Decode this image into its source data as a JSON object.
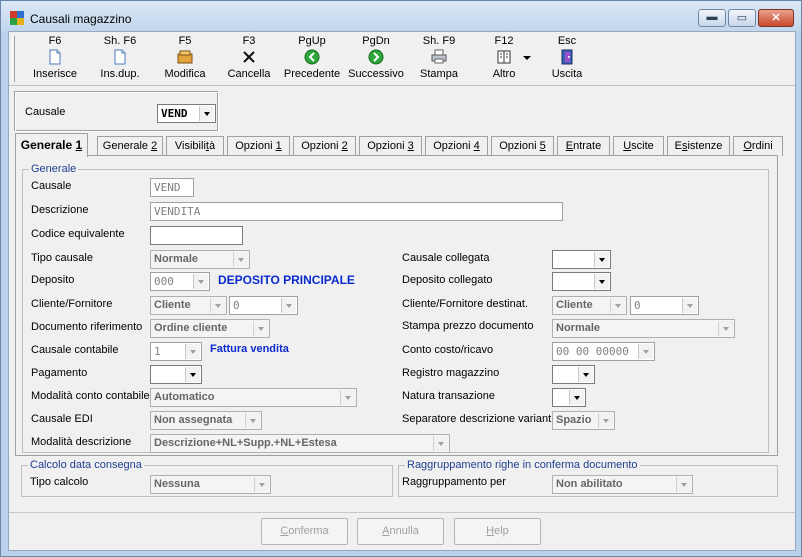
{
  "window": {
    "title": "Causali magazzino",
    "min": "▬",
    "max": "▭",
    "close": "✕"
  },
  "toolbar": [
    {
      "key": "F6",
      "label": "Inserisce",
      "icon": "new-document-icon"
    },
    {
      "key": "Sh. F6",
      "label": "Ins.dup.",
      "icon": "duplicate-document-icon"
    },
    {
      "key": "F5",
      "label": "Modifica",
      "icon": "edit-icon"
    },
    {
      "key": "F3",
      "label": "Cancella",
      "icon": "delete-x-icon"
    },
    {
      "key": "PgUp",
      "label": "Precedente",
      "icon": "previous-arrow-icon"
    },
    {
      "key": "PgDn",
      "label": "Successivo",
      "icon": "next-arrow-icon"
    },
    {
      "key": "Sh. F9",
      "label": "Stampa",
      "icon": "printer-icon"
    },
    {
      "key": "F12",
      "label": "Altro",
      "icon": "book-icon"
    },
    {
      "key": "Esc",
      "label": "Uscita",
      "icon": "exit-door-icon"
    }
  ],
  "causale": {
    "label": "Causale",
    "value": "VEND"
  },
  "tabs": [
    {
      "pre": "Generale ",
      "u": "1",
      "post": ""
    },
    {
      "pre": "Generale ",
      "u": "2",
      "post": ""
    },
    {
      "pre": "Visibili",
      "u": "t",
      "post": "à"
    },
    {
      "pre": "Opzioni ",
      "u": "1",
      "post": ""
    },
    {
      "pre": "Opzioni ",
      "u": "2",
      "post": ""
    },
    {
      "pre": "Opzioni ",
      "u": "3",
      "post": ""
    },
    {
      "pre": "Opzioni ",
      "u": "4",
      "post": ""
    },
    {
      "pre": "Opzioni ",
      "u": "5",
      "post": ""
    },
    {
      "pre": "",
      "u": "E",
      "post": "ntrate"
    },
    {
      "pre": "",
      "u": "U",
      "post": "scite"
    },
    {
      "pre": "E",
      "u": "s",
      "post": "istenze"
    },
    {
      "pre": "",
      "u": "O",
      "post": "rdini"
    }
  ],
  "generale": {
    "group_title": "Generale",
    "causale_label": "Causale",
    "causale_value": "VEND",
    "descrizione_label": "Descrizione",
    "descrizione_value": "VENDITA",
    "codice_equivalente_label": "Codice equivalente",
    "codice_equivalente_value": "",
    "tipo_causale_label": "Tipo causale",
    "tipo_causale_value": "Normale",
    "deposito_label": "Deposito",
    "deposito_value": "000",
    "deposito_desc": "DEPOSITO PRINCIPALE",
    "cliente_fornitore_label": "Cliente/Fornitore",
    "cliente_fornitore_value": "Cliente",
    "cliente_fornitore_code": "0",
    "documento_riferimento_label": "Documento riferimento",
    "documento_riferimento_value": "Ordine cliente",
    "causale_contabile_label": "Causale contabile",
    "causale_contabile_value": "1",
    "causale_contabile_desc": "Fattura vendita",
    "pagamento_label": "Pagamento",
    "pagamento_value": "",
    "modalita_conto_label": "Modalità conto contabile",
    "modalita_conto_value": "Automatico",
    "causale_edi_label": "Causale EDI",
    "causale_edi_value": "Non assegnata",
    "modalita_descrizione_label": "Modalità descrizione",
    "modalita_descrizione_value": "Descrizione+NL+Supp.+NL+Estesa",
    "causale_collegata_label": "Causale collegata",
    "causale_collegata_value": "",
    "deposito_collegato_label": "Deposito collegato",
    "deposito_collegato_value": "",
    "cliente_fornitore_dest_label": "Cliente/Fornitore destinat.",
    "cliente_fornitore_dest_value": "Cliente",
    "cliente_fornitore_dest_code": "0",
    "stampa_prezzo_label": "Stampa prezzo documento",
    "stampa_prezzo_value": "Normale",
    "conto_costo_label": "Conto costo/ricavo",
    "conto_costo_value": "00 00 00000",
    "registro_magazzino_label": "Registro magazzino",
    "registro_magazzino_value": "",
    "natura_transazione_label": "Natura transazione",
    "natura_transazione_value": "",
    "separatore_label": "Separatore descrizione varianti",
    "separatore_value": "Spazio"
  },
  "consegna": {
    "group_title": "Calcolo data consegna",
    "tipo_calcolo_label": "Tipo calcolo",
    "tipo_calcolo_value": "Nessuna"
  },
  "raggruppamento": {
    "group_title": "Raggruppamento righe in conferma documento",
    "per_label": "Raggruppamento per",
    "per_value": "Non abilitato"
  },
  "buttons": {
    "conferma": {
      "u": "C",
      "rest": "onferma"
    },
    "annulla": {
      "u": "A",
      "rest": "nnulla"
    },
    "help": {
      "u": "H",
      "rest": "elp"
    }
  },
  "colors": {
    "accent_blue": "#0a2ad0",
    "group_title": "#1f3f8f"
  }
}
